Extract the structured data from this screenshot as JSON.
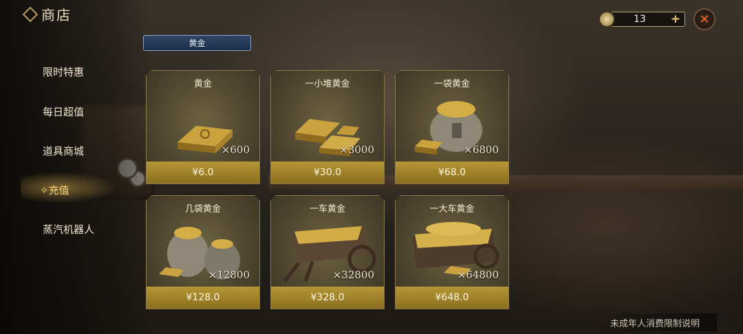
{
  "header": {
    "title": "商店"
  },
  "currency": {
    "value": "13"
  },
  "category_tab": "黄金",
  "sidebar": {
    "items": [
      {
        "label": "限时特惠"
      },
      {
        "label": "每日超值"
      },
      {
        "label": "道具商城"
      },
      {
        "label": "充值"
      },
      {
        "label": "蒸汽机器人"
      }
    ],
    "active_index": 3
  },
  "products": [
    {
      "name": "黄金",
      "qty": "×600",
      "price": "¥6.0"
    },
    {
      "name": "一小堆黄金",
      "qty": "×3000",
      "price": "¥30.0"
    },
    {
      "name": "一袋黄金",
      "qty": "×6800",
      "price": "¥68.0"
    },
    {
      "name": "几袋黄金",
      "qty": "×12800",
      "price": "¥128.0"
    },
    {
      "name": "一车黄金",
      "qty": "×32800",
      "price": "¥328.0"
    },
    {
      "name": "一大车黄金",
      "qty": "×64800",
      "price": "¥648.0"
    }
  ],
  "footer": {
    "note": "未成年人消费限制说明"
  },
  "icons": {
    "currency": "gold-bar-coin-icon",
    "add": "plus-icon",
    "close": "close-icon",
    "active_marker": "sparkle-icon"
  },
  "colors": {
    "accent_gold": "#b69635",
    "tab_blue": "#2d4566",
    "close_orange": "#ff6a1f"
  }
}
